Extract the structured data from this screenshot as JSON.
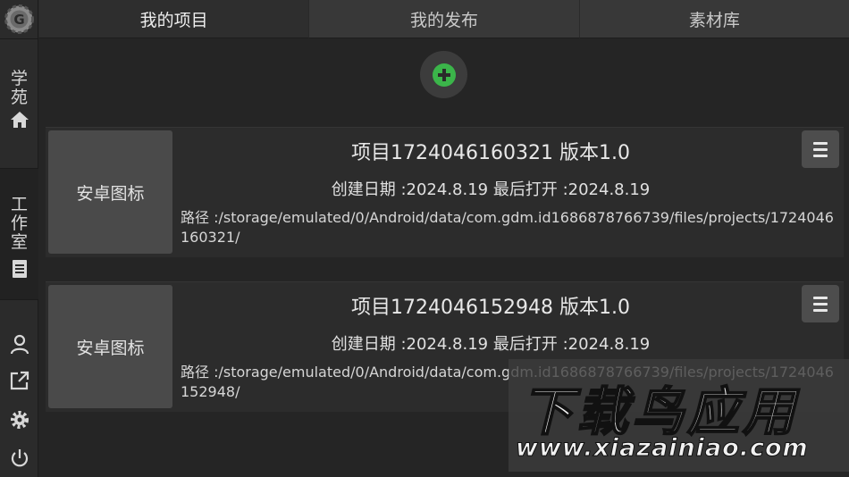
{
  "sidebar": {
    "items": [
      {
        "label": "学苑",
        "icon": "home-icon"
      },
      {
        "label": "工作室",
        "icon": "document-icon"
      }
    ],
    "bottom_icons": [
      "user-icon",
      "share-icon",
      "gear-icon",
      "power-icon"
    ]
  },
  "tabs": [
    {
      "label": "我的项目",
      "active": true
    },
    {
      "label": "我的发布",
      "active": false
    },
    {
      "label": "素材库",
      "active": false
    }
  ],
  "add_button": {
    "icon": "plus-circle-icon",
    "color": "#3bb54a"
  },
  "projects": [
    {
      "thumb_label": "安卓图标",
      "title": "项目1724046160321 版本1.0",
      "dates": "创建日期 :2024.8.19  最后打开 :2024.8.19",
      "path": "路径 :/storage/emulated/0/Android/data/com.gdm.id1686878766739/files/projects/1724046160321/"
    },
    {
      "thumb_label": "安卓图标",
      "title": "项目1724046152948 版本1.0",
      "dates": "创建日期 :2024.8.19  最后打开 :2024.8.19",
      "path": "路径 :/storage/emulated/0/Android/data/com.gdm.id1686878766739/files/projects/1724046152948/"
    }
  ],
  "watermark": {
    "title": "下载鸟应用",
    "url": "www.xiazainiao.com"
  }
}
